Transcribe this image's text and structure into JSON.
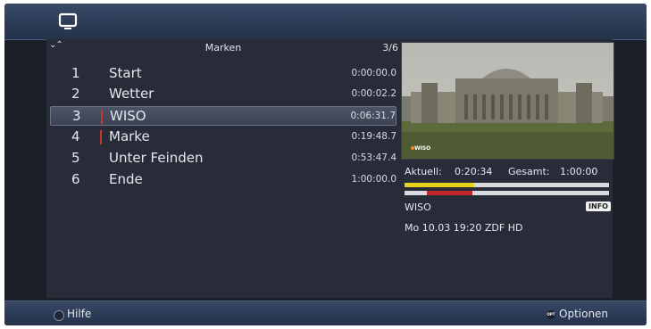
{
  "header": {
    "icon": "tv-icon"
  },
  "marks_list": {
    "title": "Marken",
    "count": "3/6",
    "sort_icon": "chevron-up-down-icon",
    "items": [
      {
        "num": "1",
        "name": "Start",
        "time": "0:00:00.0",
        "marked": false,
        "selected": false
      },
      {
        "num": "2",
        "name": "Wetter",
        "time": "0:00:02.2",
        "marked": false,
        "selected": false
      },
      {
        "num": "3",
        "name": "WISO",
        "time": "0:06:31.7",
        "marked": true,
        "selected": true
      },
      {
        "num": "4",
        "name": "Marke",
        "time": "0:19:48.7",
        "marked": true,
        "selected": false
      },
      {
        "num": "5",
        "name": "Unter Feinden",
        "time": "0:53:47.4",
        "marked": false,
        "selected": false
      },
      {
        "num": "6",
        "name": "Ende",
        "time": "1:00:00.0",
        "marked": false,
        "selected": false
      }
    ]
  },
  "preview": {
    "logo_text": "WISO"
  },
  "playback": {
    "current_label": "Aktuell:",
    "current_value": "0:20:34",
    "total_label": "Gesamt:",
    "total_value": "1:00:00",
    "progress_yellow": 0.34,
    "segment_red_start": 0.11,
    "segment_red_end": 0.33,
    "color_yellow": "#e7d21c",
    "color_red": "#c0282a"
  },
  "program": {
    "title": "WISO",
    "info_badge": "INFO",
    "details": "Mo 10.03 19:20  ZDF HD"
  },
  "footer": {
    "help_label": "Hilfe",
    "options_badge": "OPT",
    "options_label": "Optionen"
  }
}
